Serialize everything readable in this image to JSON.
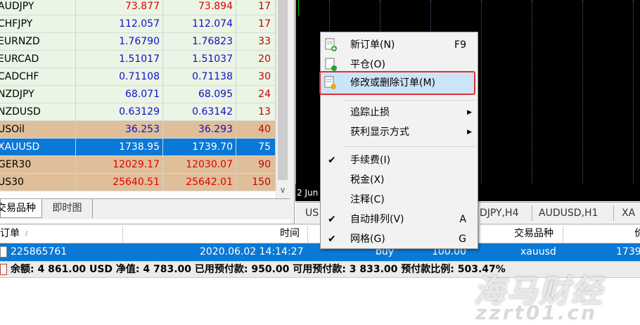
{
  "market_watch": {
    "rows": [
      {
        "symbol": "AUDJPY",
        "bid": "73.877",
        "ask": "73.894",
        "spread": "17",
        "bg": "#eaf5e5",
        "price_color": "#e00000"
      },
      {
        "symbol": "CHFJPY",
        "bid": "112.057",
        "ask": "112.074",
        "spread": "17",
        "bg": "#eaf5e5",
        "price_color": "#1010c8"
      },
      {
        "symbol": "EURNZD",
        "bid": "1.76790",
        "ask": "1.76823",
        "spread": "33",
        "bg": "#eaf5e5",
        "price_color": "#1010c8"
      },
      {
        "symbol": "EURCAD",
        "bid": "1.51017",
        "ask": "1.51037",
        "spread": "20",
        "bg": "#eaf5e5",
        "price_color": "#1010c8"
      },
      {
        "symbol": "CADCHF",
        "bid": "0.71108",
        "ask": "0.71138",
        "spread": "30",
        "bg": "#eaf5e5",
        "price_color": "#1010c8"
      },
      {
        "symbol": "NZDJPY",
        "bid": "68.071",
        "ask": "68.095",
        "spread": "24",
        "bg": "#eaf5e5",
        "price_color": "#1010c8"
      },
      {
        "symbol": "NZDUSD",
        "bid": "0.63129",
        "ask": "0.63142",
        "spread": "13",
        "bg": "#eaf5e5",
        "price_color": "#1010c8"
      },
      {
        "symbol": "USOil",
        "bid": "36.253",
        "ask": "36.293",
        "spread": "40",
        "bg": "#dfbf99",
        "price_color": "#1010c8"
      },
      {
        "symbol": "XAUUSD",
        "bid": "1738.95",
        "ask": "1739.70",
        "spread": "75",
        "bg": "#0a78d7",
        "price_color": "#ffffff"
      },
      {
        "symbol": "GER30",
        "bid": "12029.17",
        "ask": "12030.07",
        "spread": "90",
        "bg": "#dfbf99",
        "price_color": "#e00000"
      },
      {
        "symbol": "US30",
        "bid": "25640.51",
        "ask": "25642.01",
        "spread": "150",
        "bg": "#dfbf99",
        "price_color": "#e00000"
      }
    ],
    "tabs": {
      "symbols": "交易品种",
      "tick": "即时图"
    }
  },
  "chart": {
    "date_label": "2 Jun",
    "tabs": [
      "US",
      "DJPY,H4",
      "AUDUSD,H1",
      "XA"
    ]
  },
  "terminal": {
    "headers": {
      "order": "订单",
      "sort_mark": "/",
      "time": "时间",
      "symbol": "交易品种",
      "price": "价"
    },
    "row": {
      "order": "225865761",
      "time": "2020.06.02 14:14:27",
      "type": "buy",
      "volume": "100.00",
      "symbol": "xauusd",
      "price": "1739"
    },
    "status": "余额: 4 861.00 USD  净值: 4 783.00  已用预付款: 950.00  可用预付款: 3 833.00  预付款比例: 503.47%"
  },
  "context_menu": {
    "new_order": {
      "label": "新订单(N)",
      "key": "F9"
    },
    "close": {
      "label": "平仓(O)"
    },
    "modify": {
      "label": "修改或删除订单(M)"
    },
    "trailing": {
      "label": "追踪止损"
    },
    "profit": {
      "label": "获利显示方式"
    },
    "commission": {
      "label": "手续费(I)"
    },
    "taxes": {
      "label": "税金(X)"
    },
    "comments": {
      "label": "注释(C)"
    },
    "auto_arrange": {
      "label": "自动排列(V)",
      "key": "A"
    },
    "grid": {
      "label": "网格(G)",
      "key": "G"
    }
  },
  "watermark": {
    "line1": "海马财经",
    "line2": "zzrt01.cn"
  },
  "colors": {
    "highlight_border": "#e03030",
    "selection": "#0a78d7"
  }
}
